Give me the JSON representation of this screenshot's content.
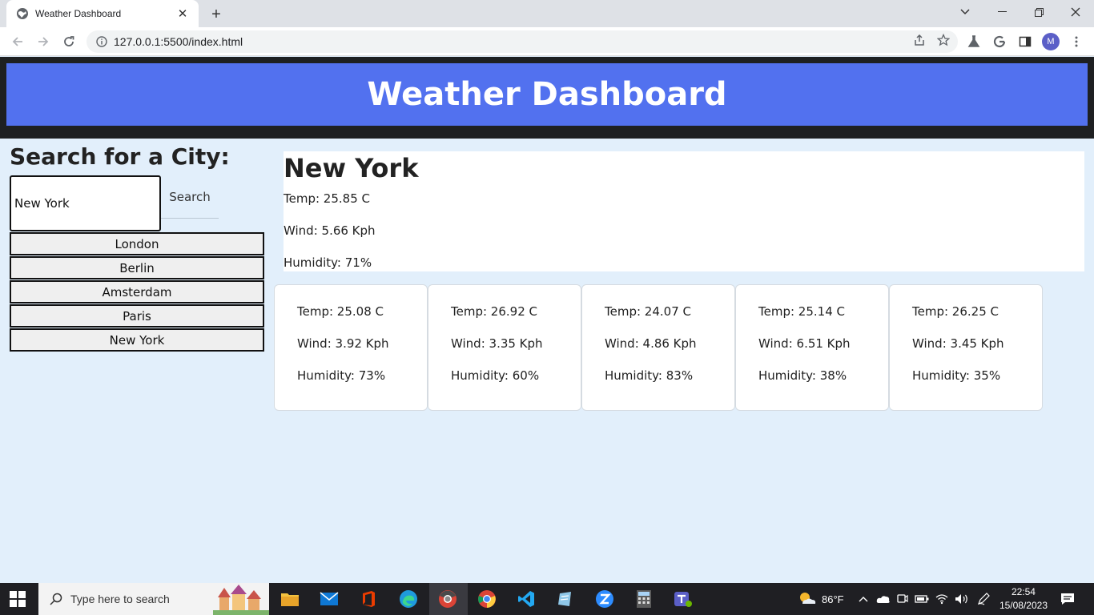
{
  "browser": {
    "tab_title": "Weather Dashboard",
    "url": "127.0.0.1:5500/index.html",
    "profile_initial": "M"
  },
  "page": {
    "header_title": "Weather Dashboard",
    "search_title": "Search for a City:",
    "search_value": "New York",
    "search_button": "Search",
    "history": [
      "London",
      "Berlin",
      "Amsterdam",
      "Paris",
      "New York"
    ],
    "current": {
      "city": "New York",
      "temp": "Temp: 25.85 C",
      "wind": "Wind: 5.66 Kph",
      "humidity": "Humidity: 71%"
    },
    "forecast": [
      {
        "temp": "Temp: 25.08 C",
        "wind": "Wind: 3.92 Kph",
        "humidity": "Humidity: 73%"
      },
      {
        "temp": "Temp: 26.92 C",
        "wind": "Wind: 3.35 Kph",
        "humidity": "Humidity: 60%"
      },
      {
        "temp": "Temp: 24.07 C",
        "wind": "Wind: 4.86 Kph",
        "humidity": "Humidity: 83%"
      },
      {
        "temp": "Temp: 25.14 C",
        "wind": "Wind: 6.51 Kph",
        "humidity": "Humidity: 38%"
      },
      {
        "temp": "Temp: 26.25 C",
        "wind": "Wind: 3.45 Kph",
        "humidity": "Humidity: 35%"
      }
    ]
  },
  "taskbar": {
    "search_placeholder": "Type here to search",
    "weather": "86°F",
    "time": "22:54",
    "date": "15/08/2023"
  },
  "colors": {
    "header_bg": "#5271ef",
    "page_bg": "#e2effb",
    "header_band": "#1e2022"
  }
}
